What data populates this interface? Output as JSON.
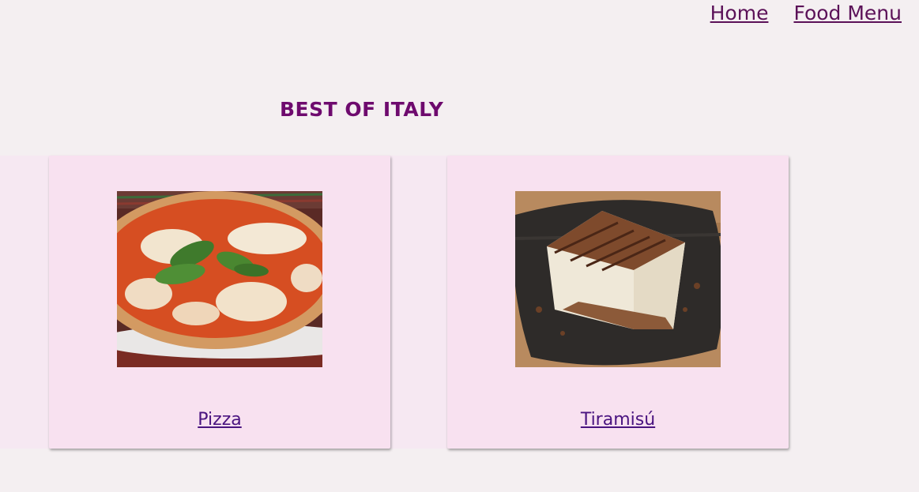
{
  "nav": {
    "home_label": "Home",
    "food_menu_label": "Food Menu"
  },
  "heading": "BEST OF ITALY",
  "cards": [
    {
      "label": "Pizza",
      "image_name": "pizza-photo"
    },
    {
      "label": "Tiramisú",
      "image_name": "tiramisu-photo"
    }
  ],
  "colors": {
    "background": "#f4eff1",
    "card": "#f8e1f0",
    "heading": "#6e0a6e",
    "link": "#5b1158"
  }
}
